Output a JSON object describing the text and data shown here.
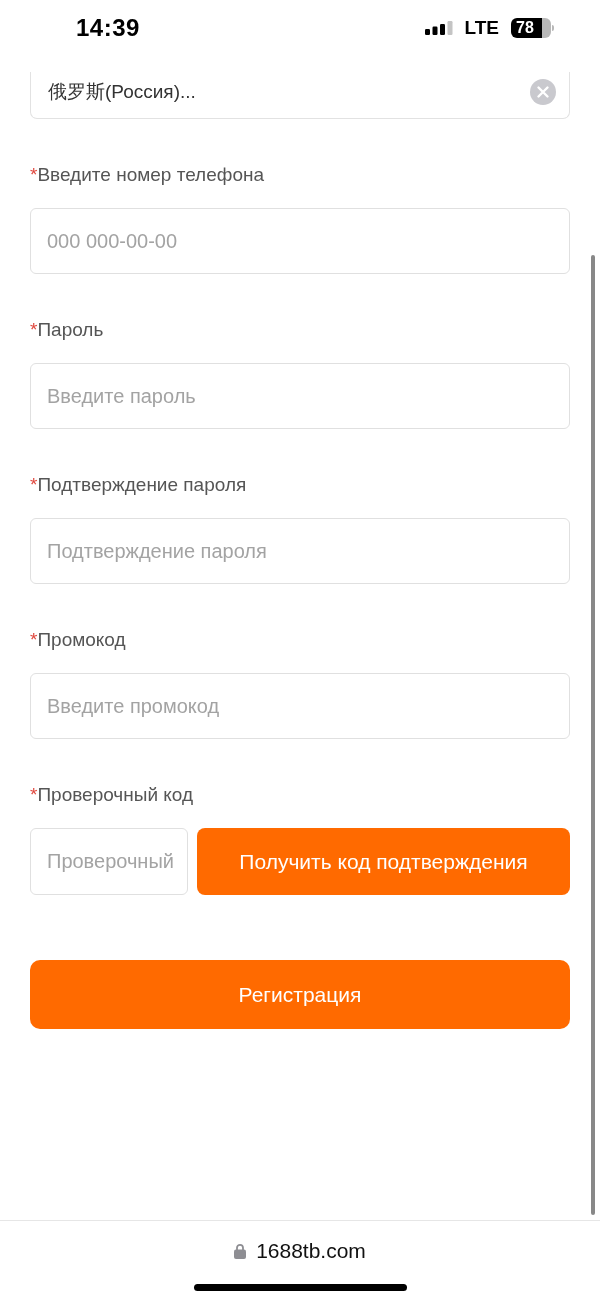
{
  "status_bar": {
    "time": "14:39",
    "network": "LTE",
    "battery": "78"
  },
  "country_field": {
    "value": "俄罗斯(Россия)..."
  },
  "fields": [
    {
      "kind": "input",
      "required_mark": "*",
      "label": "Введите номер телефона",
      "placeholder": "000 000-00-00"
    },
    {
      "kind": "input",
      "required_mark": "*",
      "label": "Пароль",
      "placeholder": "Введите пароль"
    },
    {
      "kind": "input",
      "required_mark": "*",
      "label": "Подтверждение пароля",
      "placeholder": "Подтверждение пароля"
    },
    {
      "kind": "input",
      "required_mark": "*",
      "label": "Промокод",
      "placeholder": "Введите промокод"
    },
    {
      "kind": "code",
      "required_mark": "*",
      "label": "Проверочный код",
      "placeholder": "Проверочный",
      "button": "Получить код подтверждения"
    }
  ],
  "submit_button": "Регистрация",
  "address_bar": {
    "url": "1688tb.com",
    "secure": true
  }
}
